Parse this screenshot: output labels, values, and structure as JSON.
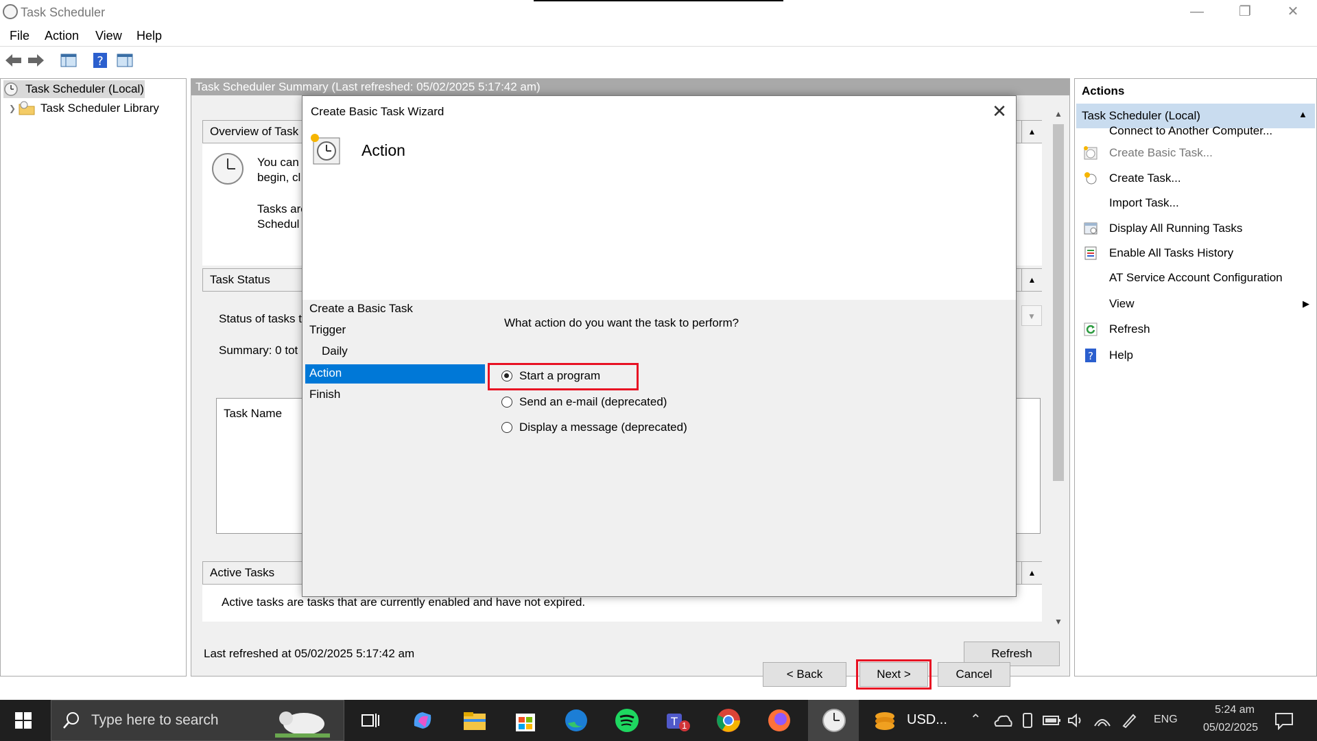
{
  "window": {
    "title": "Task Scheduler"
  },
  "menu": [
    "File",
    "Action",
    "View",
    "Help"
  ],
  "tree": {
    "root": "Task Scheduler (Local)",
    "library": "Task Scheduler Library"
  },
  "middle": {
    "header": "Task Scheduler Summary (Last refreshed: 05/02/2025 5:17:42 am)",
    "overview_title": "Overview of Task Scheduler",
    "overview_line1": "You can",
    "overview_line2": "begin, cl",
    "overview_line3": "Tasks are",
    "overview_line4": "Schedul",
    "status_title": "Task Status",
    "status_of_tasks": "Status of tasks t",
    "summary_text": "Summary: 0 tot",
    "task_name_header": "Task Name",
    "active_title": "Active Tasks",
    "active_desc": "Active tasks are tasks that are currently enabled and have not expired.",
    "last_refreshed": "Last refreshed at 05/02/2025 5:17:42 am",
    "refresh_button": "Refresh"
  },
  "actions": {
    "title": "Actions",
    "group": "Task Scheduler (Local)",
    "items": [
      {
        "label": "Connect to Another Computer...",
        "icon": "none",
        "enabled": true
      },
      {
        "label": "Create Basic Task...",
        "icon": "create-basic-task-icon",
        "enabled": false
      },
      {
        "label": "Create Task...",
        "icon": "create-task-icon",
        "enabled": true
      },
      {
        "label": "Import Task...",
        "icon": "none",
        "enabled": true
      },
      {
        "label": "Display All Running Tasks",
        "icon": "running-tasks-icon",
        "enabled": true
      },
      {
        "label": "Enable All Tasks History",
        "icon": "history-icon",
        "enabled": true
      },
      {
        "label": "AT Service Account Configuration",
        "icon": "none",
        "enabled": true
      },
      {
        "label": "View",
        "icon": "none",
        "enabled": true,
        "submenu": true
      },
      {
        "label": "Refresh",
        "icon": "refresh-icon",
        "enabled": true
      },
      {
        "label": "Help",
        "icon": "help-icon",
        "enabled": true
      }
    ]
  },
  "dialog": {
    "title": "Create Basic Task Wizard",
    "heading": "Action",
    "steps": [
      "Create a Basic Task",
      "Trigger",
      "Daily",
      "Action",
      "Finish"
    ],
    "selected_step": "Action",
    "question": "What action do you want the task to perform?",
    "options": [
      {
        "label": "Start a program",
        "selected": true
      },
      {
        "label": "Send an e-mail (deprecated)",
        "selected": false
      },
      {
        "label": "Display a message (deprecated)",
        "selected": false
      }
    ],
    "back_button": "< Back",
    "next_button": "Next >",
    "cancel_button": "Cancel"
  },
  "taskbar": {
    "search_placeholder": "Type here to search",
    "usd_label": "USD...",
    "language": "ENG",
    "time": "5:24 am",
    "date": "05/02/2025",
    "teams_badge": "1"
  },
  "colors": {
    "accent": "#0078d7",
    "highlight_box": "#e81123",
    "selection": "#0078d7"
  }
}
